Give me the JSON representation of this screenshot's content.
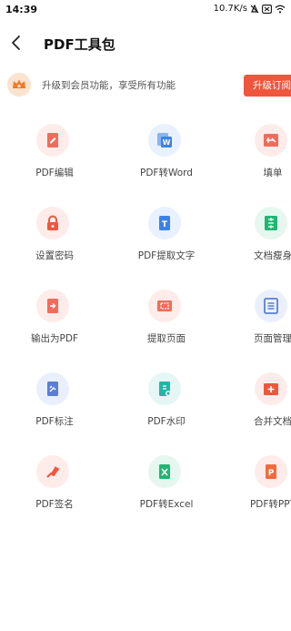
{
  "status": {
    "time": "14:39",
    "speed": "10.7K/s"
  },
  "header": {
    "title": "PDF工具包"
  },
  "banner": {
    "text": "升级到会员功能，享受所有功能",
    "button": "升级订阅"
  },
  "tools": [
    {
      "label": "PDF编辑",
      "icon": "pdf-edit-icon",
      "color": "#f26b5b",
      "bg": "#fdecea"
    },
    {
      "label": "PDF转Word",
      "icon": "pdf-to-word-icon",
      "color": "#3b82e6",
      "bg": "#e8f1fd"
    },
    {
      "label": "填单",
      "icon": "fill-form-icon",
      "color": "#f26b5b",
      "bg": "#fdecea"
    },
    {
      "label": "设置密码",
      "icon": "lock-icon",
      "color": "#f0563d",
      "bg": "#fdecea"
    },
    {
      "label": "PDF提取文字",
      "icon": "extract-text-icon",
      "color": "#3b82e6",
      "bg": "#e8f1fd"
    },
    {
      "label": "文档瘦身",
      "icon": "compress-icon",
      "color": "#22b573",
      "bg": "#e6f7ef"
    },
    {
      "label": "输出为PDF",
      "icon": "export-pdf-icon",
      "color": "#f26b5b",
      "bg": "#fdecea"
    },
    {
      "label": "提取页面",
      "icon": "extract-page-icon",
      "color": "#f26b5b",
      "bg": "#fdecea"
    },
    {
      "label": "页面管理",
      "icon": "page-manage-icon",
      "color": "#5b7fd6",
      "bg": "#eaf0fb"
    },
    {
      "label": "PDF标注",
      "icon": "annotate-icon",
      "color": "#5b7fd6",
      "bg": "#eaf0fb"
    },
    {
      "label": "PDF水印",
      "icon": "watermark-icon",
      "color": "#22b5a8",
      "bg": "#e5f6f4"
    },
    {
      "label": "合并文档",
      "icon": "merge-icon",
      "color": "#f0563d",
      "bg": "#fdecea"
    },
    {
      "label": "PDF签名",
      "icon": "signature-icon",
      "color": "#f0563d",
      "bg": "#fdecea"
    },
    {
      "label": "PDF转Excel",
      "icon": "pdf-to-excel-icon",
      "color": "#22b573",
      "bg": "#e6f7ef"
    },
    {
      "label": "PDF转PPT",
      "icon": "pdf-to-ppt-icon",
      "color": "#f26b3d",
      "bg": "#fdecea"
    }
  ]
}
